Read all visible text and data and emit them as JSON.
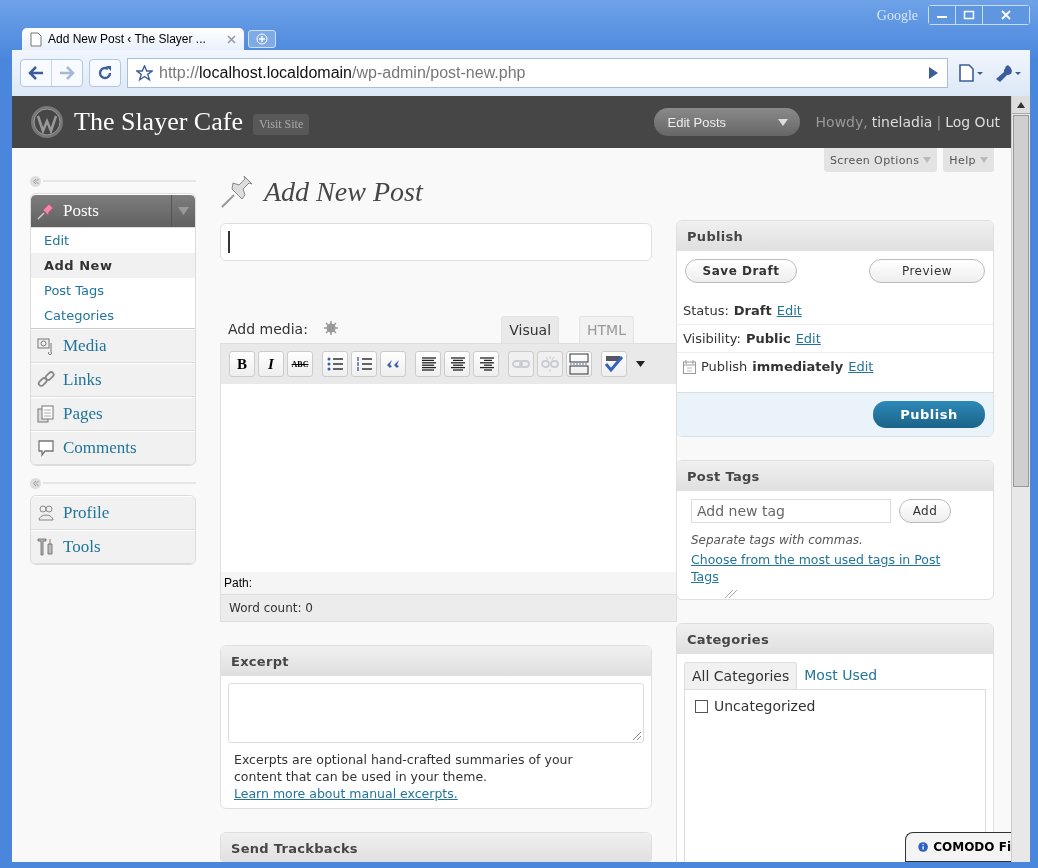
{
  "browser": {
    "tab_title": "Add New Post ‹ The Slayer ...",
    "brand": "Google",
    "url": {
      "scheme": "http://",
      "host": "localhost.localdomain",
      "path": "/wp-admin/post-new.php"
    }
  },
  "header": {
    "site_title": "The Slayer Cafe",
    "visit_site": "Visit Site",
    "edit_posts": "Edit Posts",
    "howdy": "Howdy,",
    "user": "tineladia",
    "separator": "|",
    "logout": "Log Out"
  },
  "screen_tabs": [
    "Screen Options",
    "Help"
  ],
  "sidebar": {
    "groups": [
      [
        {
          "label": "Posts",
          "expanded": true,
          "children": [
            {
              "label": "Edit",
              "selected": false
            },
            {
              "label": "Add New",
              "selected": true
            },
            {
              "label": "Post Tags",
              "selected": false
            },
            {
              "label": "Categories",
              "selected": false
            }
          ]
        },
        {
          "label": "Media"
        },
        {
          "label": "Links"
        },
        {
          "label": "Pages"
        },
        {
          "label": "Comments"
        }
      ],
      [
        {
          "label": "Profile"
        },
        {
          "label": "Tools"
        }
      ]
    ]
  },
  "page_title": "Add New Post",
  "editor": {
    "add_media": "Add media:",
    "tabs": [
      {
        "label": "Visual",
        "selected": true
      },
      {
        "label": "HTML",
        "selected": false
      }
    ],
    "toolbar": [
      [
        {
          "kind": "bold",
          "label": "B",
          "disabled": false
        },
        {
          "kind": "italic",
          "label": "I",
          "disabled": false
        },
        {
          "kind": "strike",
          "label": "ABC",
          "disabled": false
        }
      ],
      [
        {
          "kind": "bullets",
          "disabled": false
        },
        {
          "kind": "numbers",
          "disabled": false
        },
        {
          "kind": "quote",
          "disabled": false
        }
      ],
      [
        {
          "kind": "align-left",
          "disabled": false
        },
        {
          "kind": "align-center",
          "disabled": false
        },
        {
          "kind": "align-right",
          "disabled": false
        }
      ],
      [
        {
          "kind": "link",
          "disabled": true
        },
        {
          "kind": "unlink",
          "disabled": true
        },
        {
          "kind": "more",
          "disabled": false
        }
      ],
      [
        {
          "kind": "spell",
          "disabled": false
        }
      ]
    ],
    "path": "Path:",
    "word_count": "Word count: 0"
  },
  "excerpt": {
    "title": "Excerpt",
    "help": "Excerpts are optional hand-crafted summaries of your content that can be used in your theme.",
    "link": "Learn more about manual excerpts."
  },
  "trackbacks": {
    "title": "Send Trackbacks"
  },
  "publish": {
    "title": "Publish",
    "save_draft": "Save Draft",
    "preview": "Preview",
    "rows": [
      {
        "kind": "status",
        "label": "Status:",
        "value": "Draft",
        "link": "Edit"
      },
      {
        "kind": "visibility",
        "label": "Visibility:",
        "value": "Public",
        "link": "Edit"
      },
      {
        "kind": "schedule",
        "label": "Publish",
        "value": "immediately",
        "link": "Edit"
      }
    ],
    "button": "Publish"
  },
  "post_tags": {
    "title": "Post Tags",
    "placeholder": "Add new tag",
    "add": "Add",
    "hint": "Separate tags with commas.",
    "link": "Choose from the most used tags in Post Tags"
  },
  "categories": {
    "title": "Categories",
    "tabs": [
      {
        "label": "All Categories",
        "selected": true
      },
      {
        "label": "Most Used",
        "selected": false
      }
    ],
    "items": [
      {
        "label": "Uncategorized",
        "checked": false
      }
    ]
  },
  "notification": {
    "text": "COMODO Fi"
  }
}
